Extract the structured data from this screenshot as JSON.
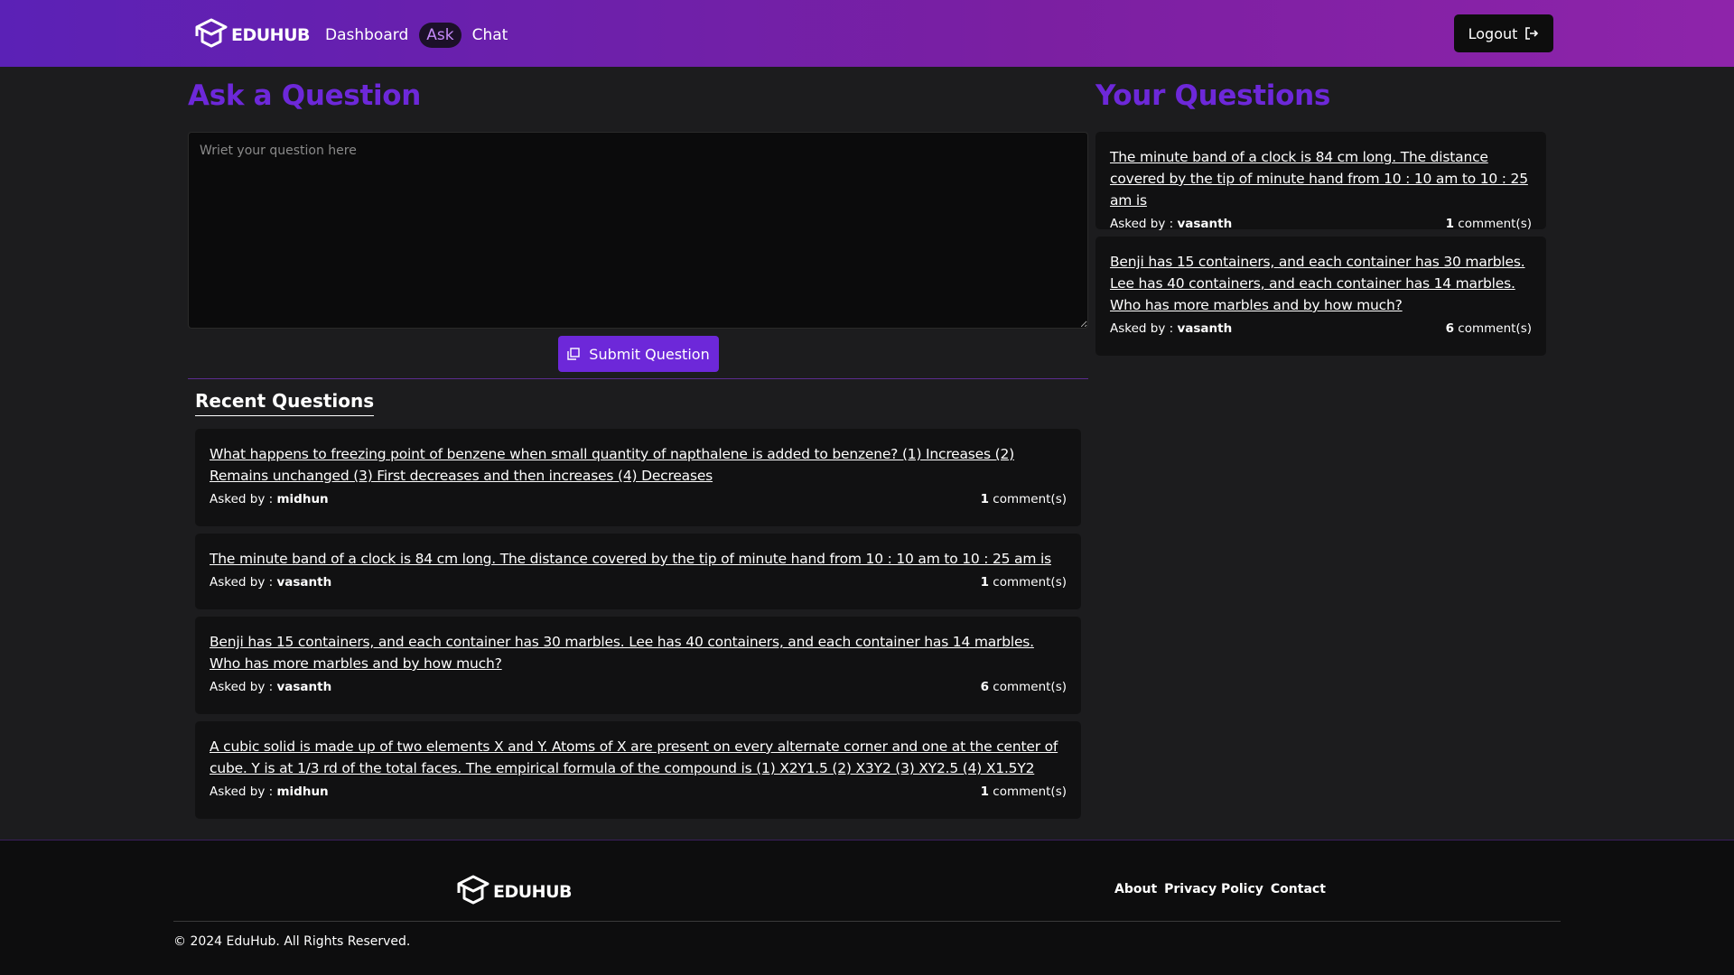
{
  "header": {
    "logo_text": "EDUHUB",
    "nav": [
      {
        "label": "Dashboard",
        "active": false
      },
      {
        "label": "Ask",
        "active": true
      },
      {
        "label": "Chat",
        "active": false
      }
    ],
    "logout_label": "Logout"
  },
  "ask": {
    "title": "Ask a Question",
    "placeholder": "Wriet your question here",
    "submit_label": "Submit Question"
  },
  "recent": {
    "title": "Recent Questions",
    "items": [
      {
        "question": "What happens to freezing point of benzene when small quantity of napthalene is added to benzene? (1) Increases (2) Remains unchanged (3) First decreases and then increases (4) Decreases",
        "asked_by_label": "Asked by : ",
        "user": "midhun",
        "count": "1",
        "comments_label": " comment(s)"
      },
      {
        "question": "The minute band of a clock is 84 cm long. The distance covered by the tip of minute hand from 10 : 10 am to 10 : 25 am is",
        "asked_by_label": "Asked by : ",
        "user": "vasanth",
        "count": "1",
        "comments_label": " comment(s)"
      },
      {
        "question": "Benji has 15 containers, and each container has 30 marbles. Lee has 40 containers, and each container has 14 marbles. Who has more marbles and by how much?",
        "asked_by_label": "Asked by : ",
        "user": "vasanth",
        "count": "6",
        "comments_label": " comment(s)"
      },
      {
        "question": "A cubic solid is made up of two elements X and Y. Atoms of X are present on every alternate corner and one at the center of cube. Y is at 1/3 rd of the total faces. The empirical formula of the compound is (1) X2Y1.5 (2) X3Y2 (3) XY2.5 (4) X1.5Y2",
        "asked_by_label": "Asked by : ",
        "user": "midhun",
        "count": "1",
        "comments_label": " comment(s)"
      }
    ]
  },
  "yours": {
    "title": "Your Questions",
    "items": [
      {
        "question": "The minute band of a clock is 84 cm long. The distance covered by the tip of minute hand from 10 : 10 am to 10 : 25 am is",
        "asked_by_label": "Asked by : ",
        "user": "vasanth",
        "count": "1",
        "comments_label": " comment(s)"
      },
      {
        "question": "Benji has 15 containers, and each container has 30 marbles. Lee has 40 containers, and each container has 14 marbles. Who has more marbles and by how much?",
        "asked_by_label": "Asked by : ",
        "user": "vasanth",
        "count": "6",
        "comments_label": " comment(s)"
      }
    ]
  },
  "footer": {
    "logo_text": "EDUHUB",
    "links": [
      "About",
      "Privacy Policy",
      "Contact"
    ],
    "copyright": "© 2024 EduHub. All Rights Reserved."
  },
  "colors": {
    "accent": "#6d28d9",
    "header_gradient_start": "#5b21b6",
    "header_gradient_end": "#8e24aa",
    "background": "#1c1c1e"
  }
}
